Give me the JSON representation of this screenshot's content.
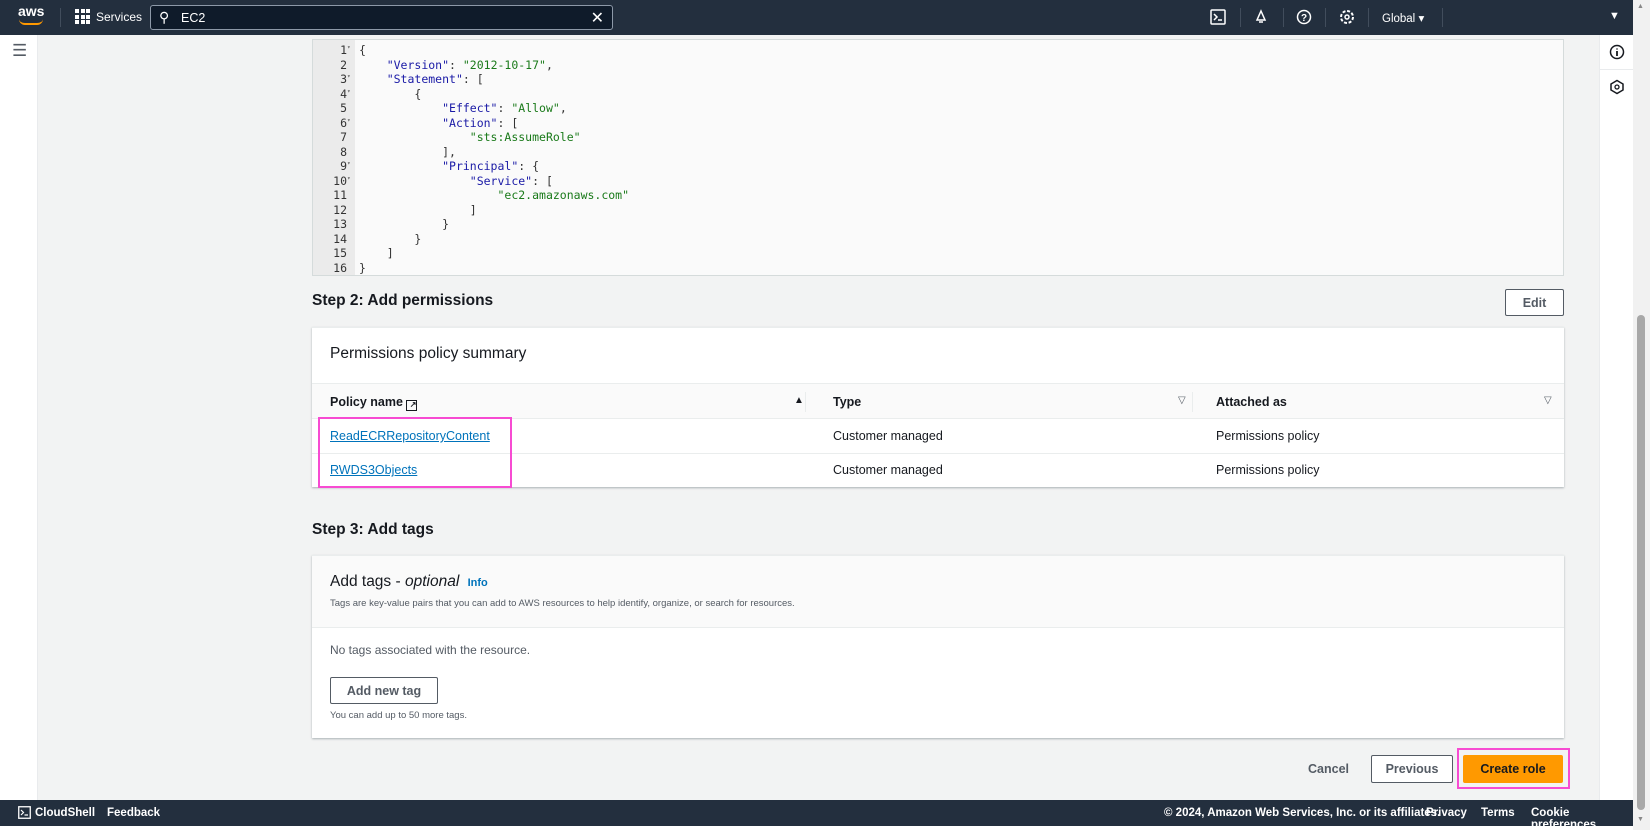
{
  "topbar": {
    "logo": "aws",
    "services_label": "Services",
    "search_value": "EC2",
    "region": "Global",
    "icons": [
      "cloudshell-icon",
      "bell-icon",
      "help-icon",
      "gear-icon"
    ]
  },
  "editor": {
    "lines": [
      {
        "n": "1",
        "fold": true,
        "text": "{"
      },
      {
        "n": "2",
        "fold": false,
        "text": "    \"Version\": \"2012-10-17\","
      },
      {
        "n": "3",
        "fold": true,
        "text": "    \"Statement\": ["
      },
      {
        "n": "4",
        "fold": true,
        "text": "        {"
      },
      {
        "n": "5",
        "fold": false,
        "text": "            \"Effect\": \"Allow\","
      },
      {
        "n": "6",
        "fold": true,
        "text": "            \"Action\": ["
      },
      {
        "n": "7",
        "fold": false,
        "text": "                \"sts:AssumeRole\""
      },
      {
        "n": "8",
        "fold": false,
        "text": "            ],"
      },
      {
        "n": "9",
        "fold": true,
        "text": "            \"Principal\": {"
      },
      {
        "n": "10",
        "fold": true,
        "text": "                \"Service\": ["
      },
      {
        "n": "11",
        "fold": false,
        "text": "                    \"ec2.amazonaws.com\""
      },
      {
        "n": "12",
        "fold": false,
        "text": "                ]"
      },
      {
        "n": "13",
        "fold": false,
        "text": "            }"
      },
      {
        "n": "14",
        "fold": false,
        "text": "        }"
      },
      {
        "n": "15",
        "fold": false,
        "text": "    ]"
      },
      {
        "n": "16",
        "fold": false,
        "text": "}"
      }
    ]
  },
  "step2": {
    "title": "Step 2: Add permissions",
    "edit_label": "Edit",
    "card_title": "Permissions policy summary",
    "columns": [
      "Policy name",
      "Type",
      "Attached as"
    ],
    "rows": [
      {
        "name": "ReadECRRepositoryContent",
        "type": "Customer managed",
        "attached": "Permissions policy"
      },
      {
        "name": "RWDS3Objects",
        "type": "Customer managed",
        "attached": "Permissions policy"
      }
    ]
  },
  "step3": {
    "title": "Step 3: Add tags",
    "card_title": "Add tags - ",
    "card_title_em": "optional",
    "info": "Info",
    "description": "Tags are key-value pairs that you can add to AWS resources to help identify, organize, or search for resources.",
    "empty": "No tags associated with the resource.",
    "add_label": "Add new tag",
    "hint": "You can add up to 50 more tags."
  },
  "actions": {
    "cancel": "Cancel",
    "previous": "Previous",
    "create": "Create role"
  },
  "footer": {
    "cloudshell": "CloudShell",
    "feedback": "Feedback",
    "copyright": "© 2024, Amazon Web Services, Inc. or its affiliates.",
    "privacy": "Privacy",
    "terms": "Terms",
    "cookies": "Cookie preferences"
  },
  "colors": {
    "nav": "#232f3e",
    "primary": "#ff9900",
    "link": "#0073bb",
    "highlight": "#f74bd2"
  }
}
